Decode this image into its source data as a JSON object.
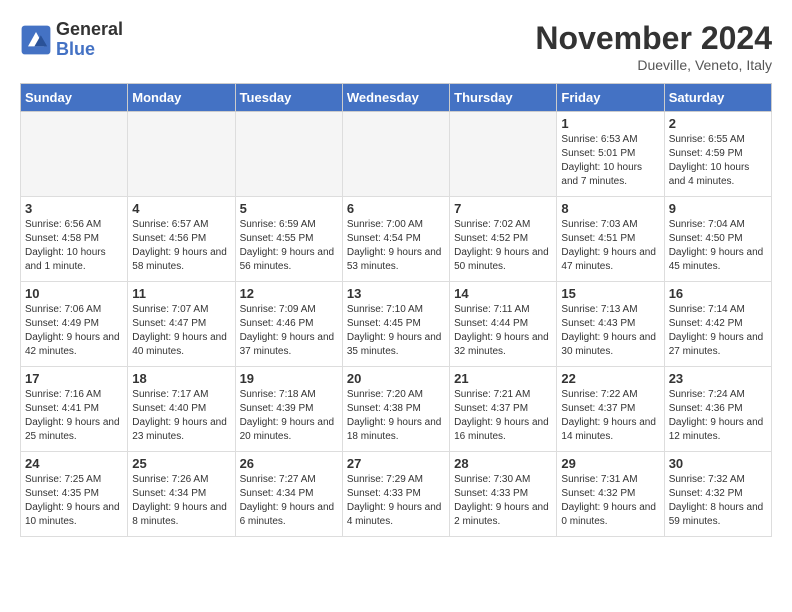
{
  "header": {
    "logo_general": "General",
    "logo_blue": "Blue",
    "title": "November 2024",
    "location": "Dueville, Veneto, Italy"
  },
  "days_of_week": [
    "Sunday",
    "Monday",
    "Tuesday",
    "Wednesday",
    "Thursday",
    "Friday",
    "Saturday"
  ],
  "weeks": [
    [
      {
        "day": "",
        "info": ""
      },
      {
        "day": "",
        "info": ""
      },
      {
        "day": "",
        "info": ""
      },
      {
        "day": "",
        "info": ""
      },
      {
        "day": "",
        "info": ""
      },
      {
        "day": "1",
        "info": "Sunrise: 6:53 AM\nSunset: 5:01 PM\nDaylight: 10 hours and 7 minutes."
      },
      {
        "day": "2",
        "info": "Sunrise: 6:55 AM\nSunset: 4:59 PM\nDaylight: 10 hours and 4 minutes."
      }
    ],
    [
      {
        "day": "3",
        "info": "Sunrise: 6:56 AM\nSunset: 4:58 PM\nDaylight: 10 hours and 1 minute."
      },
      {
        "day": "4",
        "info": "Sunrise: 6:57 AM\nSunset: 4:56 PM\nDaylight: 9 hours and 58 minutes."
      },
      {
        "day": "5",
        "info": "Sunrise: 6:59 AM\nSunset: 4:55 PM\nDaylight: 9 hours and 56 minutes."
      },
      {
        "day": "6",
        "info": "Sunrise: 7:00 AM\nSunset: 4:54 PM\nDaylight: 9 hours and 53 minutes."
      },
      {
        "day": "7",
        "info": "Sunrise: 7:02 AM\nSunset: 4:52 PM\nDaylight: 9 hours and 50 minutes."
      },
      {
        "day": "8",
        "info": "Sunrise: 7:03 AM\nSunset: 4:51 PM\nDaylight: 9 hours and 47 minutes."
      },
      {
        "day": "9",
        "info": "Sunrise: 7:04 AM\nSunset: 4:50 PM\nDaylight: 9 hours and 45 minutes."
      }
    ],
    [
      {
        "day": "10",
        "info": "Sunrise: 7:06 AM\nSunset: 4:49 PM\nDaylight: 9 hours and 42 minutes."
      },
      {
        "day": "11",
        "info": "Sunrise: 7:07 AM\nSunset: 4:47 PM\nDaylight: 9 hours and 40 minutes."
      },
      {
        "day": "12",
        "info": "Sunrise: 7:09 AM\nSunset: 4:46 PM\nDaylight: 9 hours and 37 minutes."
      },
      {
        "day": "13",
        "info": "Sunrise: 7:10 AM\nSunset: 4:45 PM\nDaylight: 9 hours and 35 minutes."
      },
      {
        "day": "14",
        "info": "Sunrise: 7:11 AM\nSunset: 4:44 PM\nDaylight: 9 hours and 32 minutes."
      },
      {
        "day": "15",
        "info": "Sunrise: 7:13 AM\nSunset: 4:43 PM\nDaylight: 9 hours and 30 minutes."
      },
      {
        "day": "16",
        "info": "Sunrise: 7:14 AM\nSunset: 4:42 PM\nDaylight: 9 hours and 27 minutes."
      }
    ],
    [
      {
        "day": "17",
        "info": "Sunrise: 7:16 AM\nSunset: 4:41 PM\nDaylight: 9 hours and 25 minutes."
      },
      {
        "day": "18",
        "info": "Sunrise: 7:17 AM\nSunset: 4:40 PM\nDaylight: 9 hours and 23 minutes."
      },
      {
        "day": "19",
        "info": "Sunrise: 7:18 AM\nSunset: 4:39 PM\nDaylight: 9 hours and 20 minutes."
      },
      {
        "day": "20",
        "info": "Sunrise: 7:20 AM\nSunset: 4:38 PM\nDaylight: 9 hours and 18 minutes."
      },
      {
        "day": "21",
        "info": "Sunrise: 7:21 AM\nSunset: 4:37 PM\nDaylight: 9 hours and 16 minutes."
      },
      {
        "day": "22",
        "info": "Sunrise: 7:22 AM\nSunset: 4:37 PM\nDaylight: 9 hours and 14 minutes."
      },
      {
        "day": "23",
        "info": "Sunrise: 7:24 AM\nSunset: 4:36 PM\nDaylight: 9 hours and 12 minutes."
      }
    ],
    [
      {
        "day": "24",
        "info": "Sunrise: 7:25 AM\nSunset: 4:35 PM\nDaylight: 9 hours and 10 minutes."
      },
      {
        "day": "25",
        "info": "Sunrise: 7:26 AM\nSunset: 4:34 PM\nDaylight: 9 hours and 8 minutes."
      },
      {
        "day": "26",
        "info": "Sunrise: 7:27 AM\nSunset: 4:34 PM\nDaylight: 9 hours and 6 minutes."
      },
      {
        "day": "27",
        "info": "Sunrise: 7:29 AM\nSunset: 4:33 PM\nDaylight: 9 hours and 4 minutes."
      },
      {
        "day": "28",
        "info": "Sunrise: 7:30 AM\nSunset: 4:33 PM\nDaylight: 9 hours and 2 minutes."
      },
      {
        "day": "29",
        "info": "Sunrise: 7:31 AM\nSunset: 4:32 PM\nDaylight: 9 hours and 0 minutes."
      },
      {
        "day": "30",
        "info": "Sunrise: 7:32 AM\nSunset: 4:32 PM\nDaylight: 8 hours and 59 minutes."
      }
    ]
  ]
}
